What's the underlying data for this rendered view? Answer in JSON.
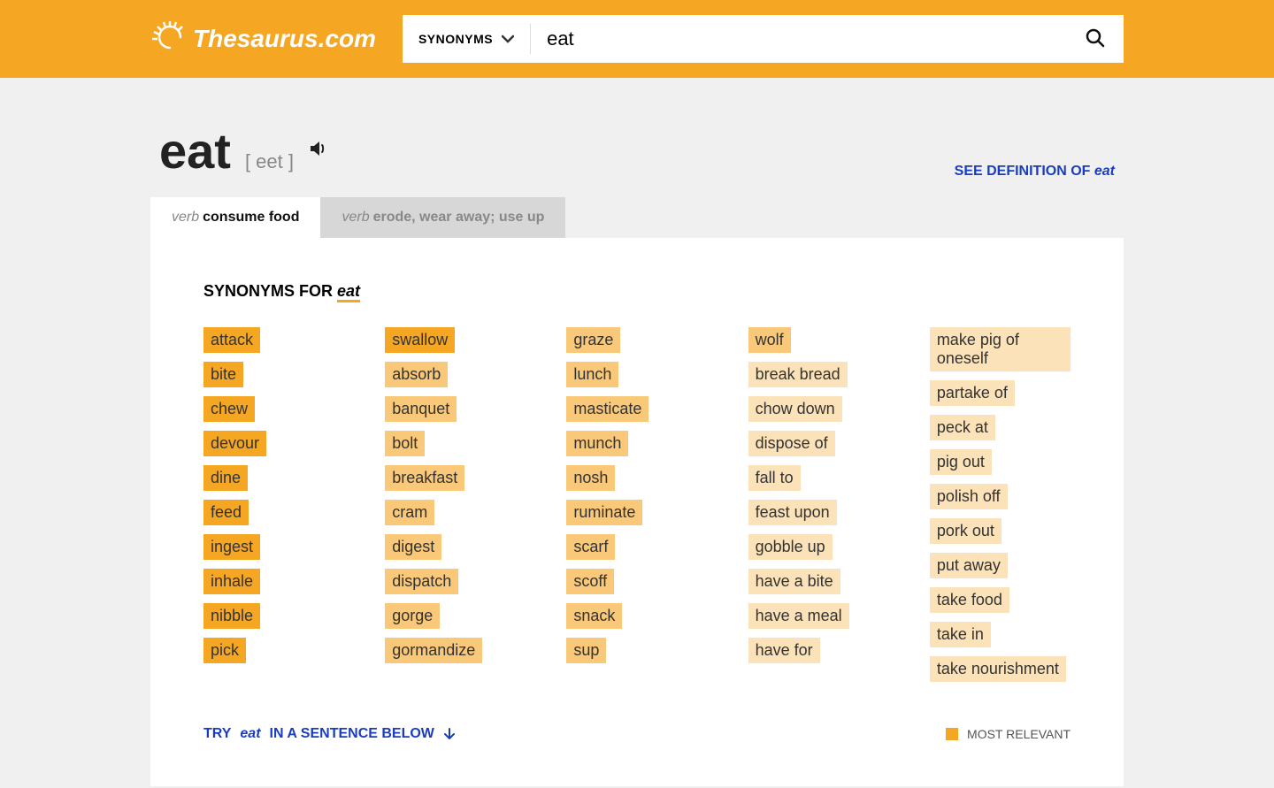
{
  "header": {
    "logo_text": "Thesaurus.com",
    "search_type_label": "SYNONYMS",
    "search_value": "eat"
  },
  "word": {
    "term": "eat",
    "pronunciation": "[ eet ]",
    "definition_link_prefix": "SEE DEFINITION OF ",
    "definition_link_word": "eat"
  },
  "tabs": [
    {
      "pos": "verb",
      "def": "consume food",
      "active": true
    },
    {
      "pos": "verb",
      "def": "erode, wear away; use up",
      "active": false
    }
  ],
  "panel": {
    "heading_prefix": "SYNONYMS FOR ",
    "heading_word": "eat",
    "columns": [
      [
        {
          "w": "attack",
          "r": 1
        },
        {
          "w": "bite",
          "r": 1
        },
        {
          "w": "chew",
          "r": 1
        },
        {
          "w": "devour",
          "r": 1
        },
        {
          "w": "dine",
          "r": 1
        },
        {
          "w": "feed",
          "r": 1
        },
        {
          "w": "ingest",
          "r": 1
        },
        {
          "w": "inhale",
          "r": 1
        },
        {
          "w": "nibble",
          "r": 1
        },
        {
          "w": "pick",
          "r": 1
        }
      ],
      [
        {
          "w": "swallow",
          "r": 1
        },
        {
          "w": "absorb",
          "r": 2
        },
        {
          "w": "banquet",
          "r": 2
        },
        {
          "w": "bolt",
          "r": 2
        },
        {
          "w": "breakfast",
          "r": 2
        },
        {
          "w": "cram",
          "r": 2
        },
        {
          "w": "digest",
          "r": 2
        },
        {
          "w": "dispatch",
          "r": 2
        },
        {
          "w": "gorge",
          "r": 2
        },
        {
          "w": "gormandize",
          "r": 2
        }
      ],
      [
        {
          "w": "graze",
          "r": 2
        },
        {
          "w": "lunch",
          "r": 2
        },
        {
          "w": "masticate",
          "r": 2
        },
        {
          "w": "munch",
          "r": 2
        },
        {
          "w": "nosh",
          "r": 2
        },
        {
          "w": "ruminate",
          "r": 2
        },
        {
          "w": "scarf",
          "r": 2
        },
        {
          "w": "scoff",
          "r": 2
        },
        {
          "w": "snack",
          "r": 2
        },
        {
          "w": "sup",
          "r": 2
        }
      ],
      [
        {
          "w": "wolf",
          "r": 2
        },
        {
          "w": "break bread",
          "r": 3
        },
        {
          "w": "chow down",
          "r": 3
        },
        {
          "w": "dispose of",
          "r": 3
        },
        {
          "w": "fall to",
          "r": 3
        },
        {
          "w": "feast upon",
          "r": 3
        },
        {
          "w": "gobble up",
          "r": 3
        },
        {
          "w": "have a bite",
          "r": 3
        },
        {
          "w": "have a meal",
          "r": 3
        },
        {
          "w": "have for",
          "r": 3
        }
      ],
      [
        {
          "w": "make pig of oneself",
          "r": 3
        },
        {
          "w": "partake of",
          "r": 3
        },
        {
          "w": "peck at",
          "r": 3
        },
        {
          "w": "pig out",
          "r": 3
        },
        {
          "w": "polish off",
          "r": 3
        },
        {
          "w": "pork out",
          "r": 3
        },
        {
          "w": "put away",
          "r": 3
        },
        {
          "w": "take food",
          "r": 3
        },
        {
          "w": "take in",
          "r": 3
        },
        {
          "w": "take nourishment",
          "r": 3
        }
      ]
    ],
    "try_prefix": "TRY ",
    "try_word": "eat",
    "try_suffix": " IN A SENTENCE BELOW",
    "legend_label": "MOST RELEVANT"
  }
}
